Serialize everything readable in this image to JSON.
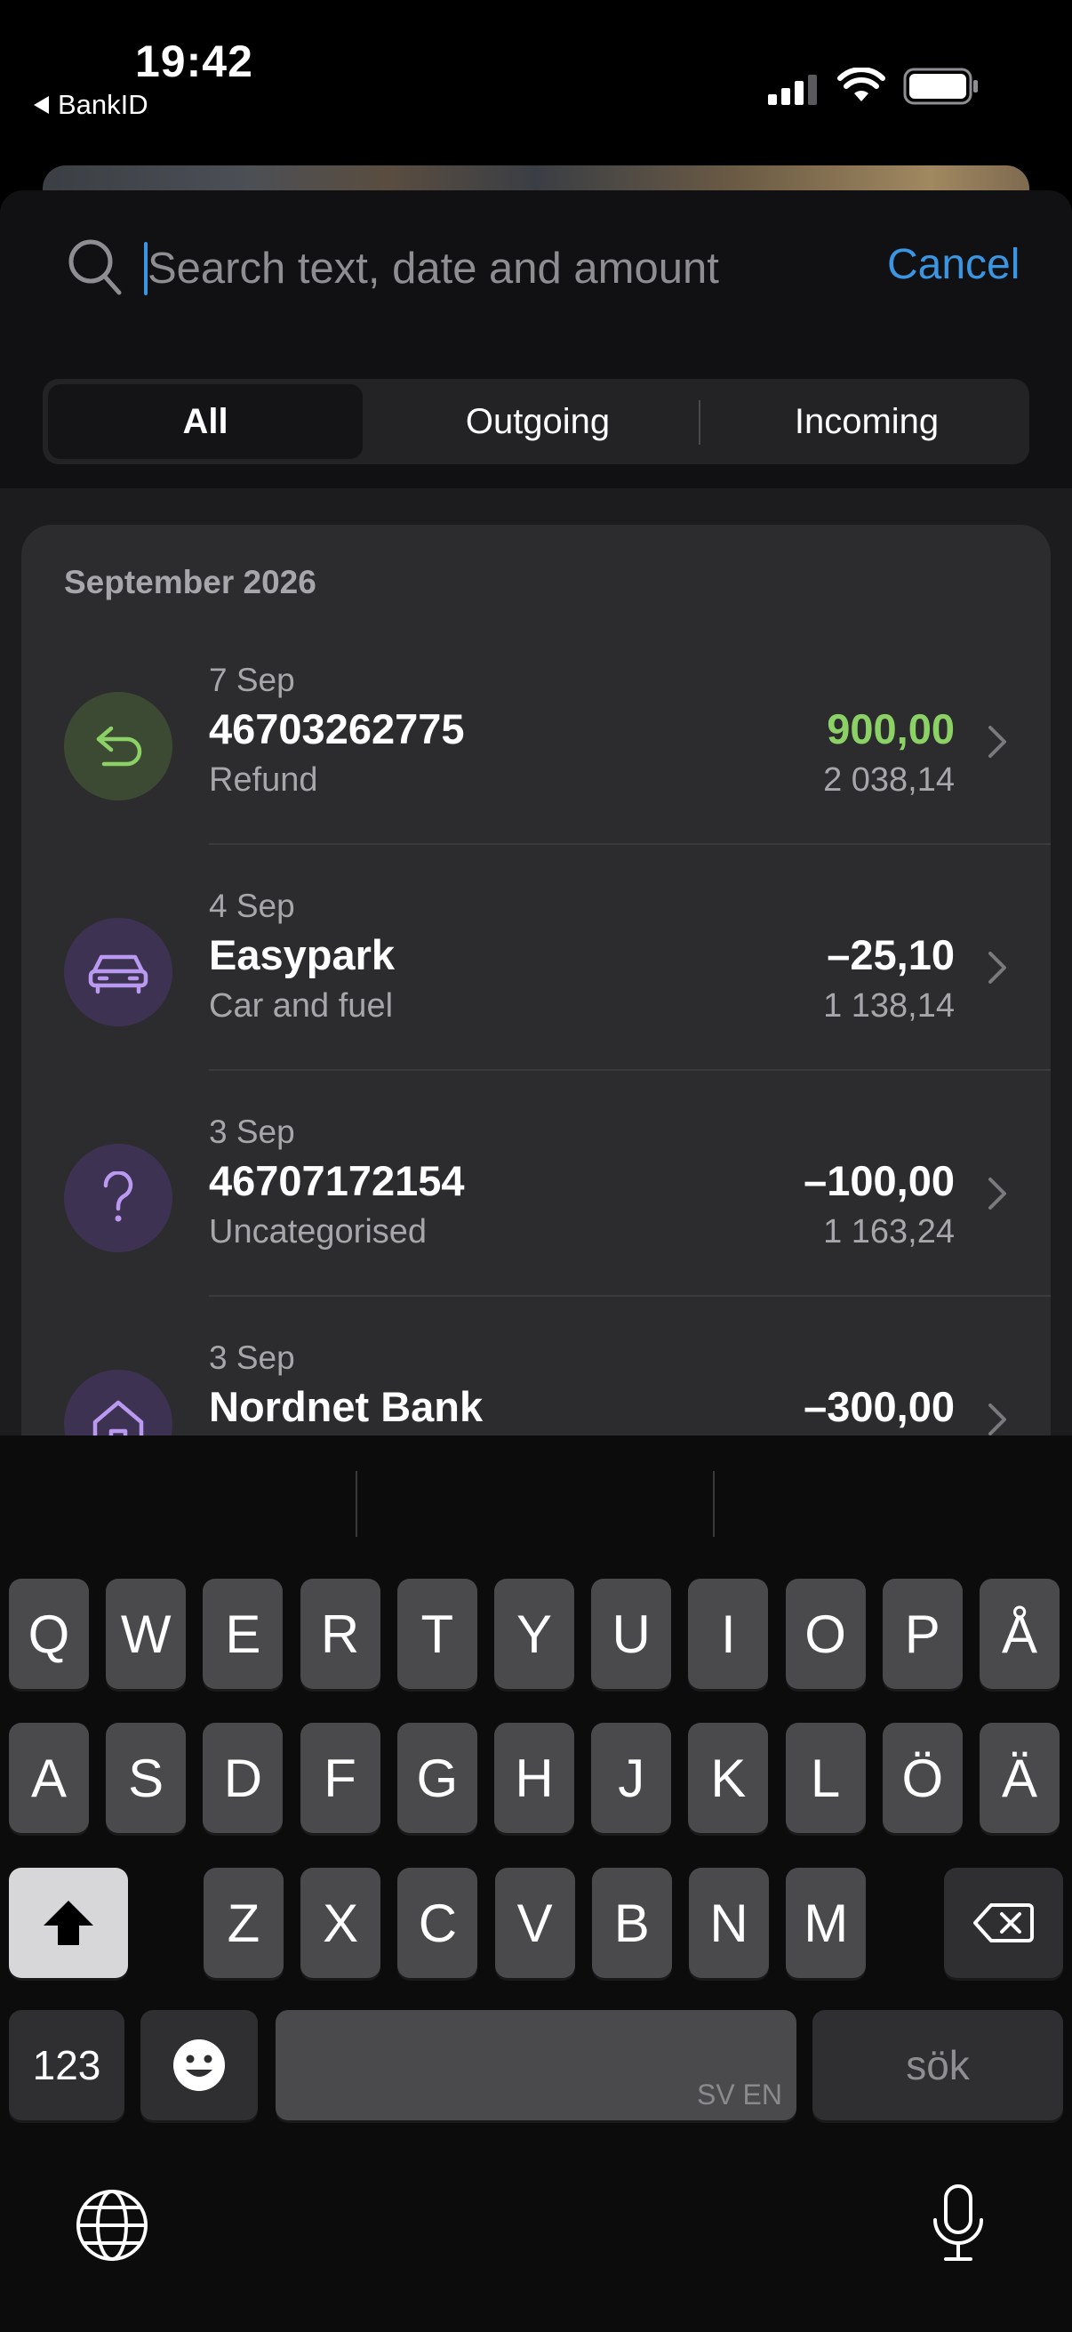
{
  "status_bar": {
    "time": "19:42",
    "back_app": "BankID"
  },
  "search": {
    "placeholder": "Search text, date and amount",
    "value": "",
    "cancel_label": "Cancel"
  },
  "filter_tabs": [
    {
      "label": "All",
      "selected": true
    },
    {
      "label": "Outgoing",
      "selected": false
    },
    {
      "label": "Incoming",
      "selected": false
    }
  ],
  "transactions": {
    "month_header": "September 2026",
    "items": [
      {
        "date": "7 Sep",
        "merchant": "46703262775",
        "category": "Refund",
        "amount": "900,00",
        "balance": "2 038,14",
        "icon": "refund-icon",
        "positive": true
      },
      {
        "date": "4 Sep",
        "merchant": "Easypark",
        "category": "Car and fuel",
        "amount": "–25,10",
        "balance": "1 138,14",
        "icon": "car-icon",
        "positive": false
      },
      {
        "date": "3 Sep",
        "merchant": "46707172154",
        "category": "Uncategorised",
        "amount": "–100,00",
        "balance": "1 163,24",
        "icon": "question-icon",
        "positive": false
      },
      {
        "date": "3 Sep",
        "merchant": "Nordnet Bank",
        "category": "",
        "amount": "–300,00",
        "balance": "",
        "icon": "house-icon",
        "positive": false
      }
    ]
  },
  "keyboard": {
    "row1": [
      "Q",
      "W",
      "E",
      "R",
      "T",
      "Y",
      "U",
      "I",
      "O",
      "P",
      "Å"
    ],
    "row2": [
      "A",
      "S",
      "D",
      "F",
      "G",
      "H",
      "J",
      "K",
      "L",
      "Ö",
      "Ä"
    ],
    "row3": [
      "Z",
      "X",
      "C",
      "V",
      "B",
      "N",
      "M"
    ],
    "numbers_key": "123",
    "space_languages": "SV EN",
    "return_key": "sök"
  },
  "colors": {
    "accent": "#3a95e2",
    "positive": "#8cd166",
    "icon_purple": "#b99af0",
    "icon_green": "#8cd166"
  }
}
